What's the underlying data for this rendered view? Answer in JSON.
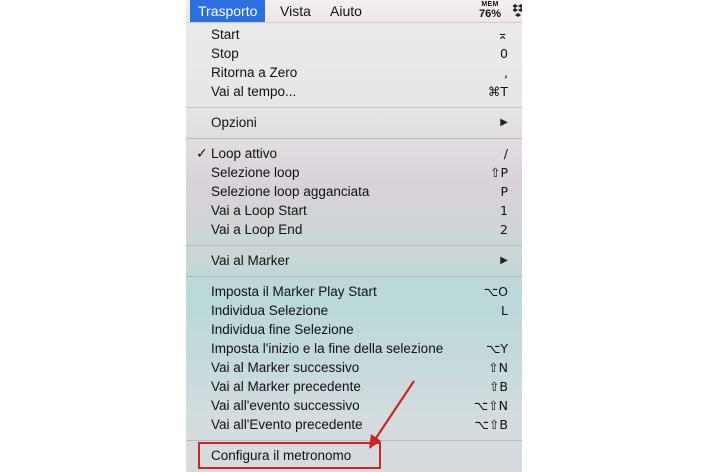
{
  "menubar": {
    "items": [
      {
        "label": "Trasporto"
      },
      {
        "label": "Vista"
      },
      {
        "label": "Aiuto"
      }
    ],
    "mem_label": "MEM",
    "mem_value": "76%",
    "dropbox_icon": "dropbox-icon"
  },
  "menu": {
    "items": [
      {
        "label": "Start",
        "shortcut": "⌅"
      },
      {
        "label": "Stop",
        "shortcut": "0"
      },
      {
        "label": "Ritorna a Zero",
        "shortcut": ","
      },
      {
        "label": "Vai al tempo...",
        "shortcut": "⌘T"
      },
      {
        "label": "Opzioni",
        "submenu": "▶"
      },
      {
        "label": "Loop attivo",
        "check": "✓",
        "shortcut": "/"
      },
      {
        "label": "Selezione loop",
        "shortcut": "⇧P"
      },
      {
        "label": "Selezione loop agganciata",
        "shortcut": "P"
      },
      {
        "label": "Vai a Loop Start",
        "shortcut": "1"
      },
      {
        "label": "Vai a Loop End",
        "shortcut": "2"
      },
      {
        "label": "Vai al Marker",
        "submenu": "▶"
      },
      {
        "label": "Imposta il Marker Play Start",
        "shortcut": "⌥O"
      },
      {
        "label": "Individua Selezione",
        "shortcut": "L"
      },
      {
        "label": "Individua fine Selezione",
        "shortcut": ""
      },
      {
        "label": "Imposta l'inizio e la fine della selezione",
        "shortcut": "⌥Y"
      },
      {
        "label": "Vai al Marker successivo",
        "shortcut": "⇧N"
      },
      {
        "label": "Vai al Marker precedente",
        "shortcut": "⇧B"
      },
      {
        "label": "Vai all'evento successivo",
        "shortcut": "⌥⇧N"
      },
      {
        "label": "Vai all'Evento precedente",
        "shortcut": "⌥⇧B"
      },
      {
        "label": "Configura il metronomo",
        "shortcut": ""
      }
    ]
  },
  "annotation": {
    "color": "#c8281e"
  }
}
